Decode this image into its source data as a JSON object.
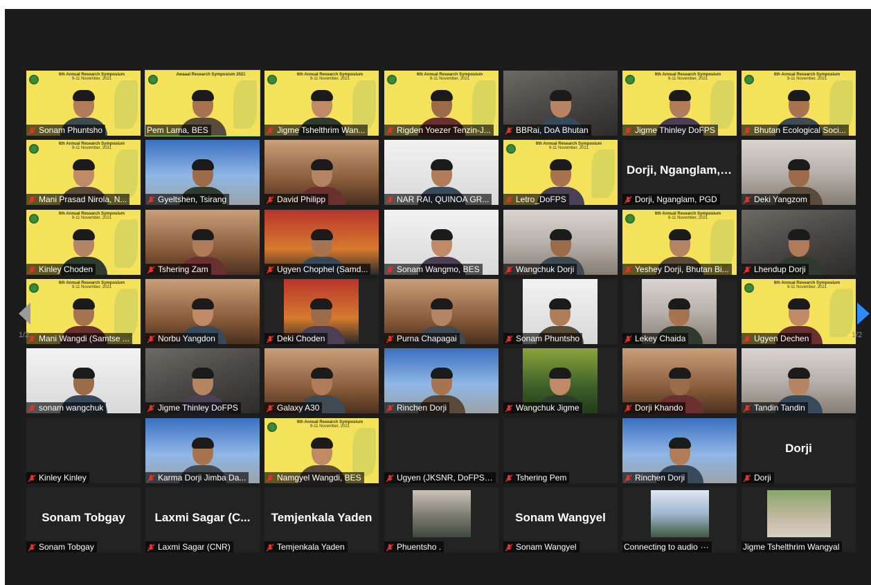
{
  "colors": {
    "stage_bg": "#1c1c1c",
    "tile_bg": "#232323",
    "active_border": "#9fe06a",
    "mic_muted": "#e0352b",
    "nav_right": "#2d8cff",
    "nav_left": "#9a9a9a"
  },
  "banner": {
    "symposium": "6th Annual Research Symposium",
    "dates": "9-11 November, 2021",
    "awaaal": "Awaaal Research Symposium 2021"
  },
  "pagination": {
    "left": "1/2",
    "right": "1/2"
  },
  "participants": [
    {
      "name": "Sonam Phuntsho",
      "muted": true,
      "bg": "yellow",
      "video": true
    },
    {
      "name": "Pem Lama, BES",
      "muted": false,
      "bg": "yellow",
      "video": true,
      "active": true
    },
    {
      "name": "Jigme Tshelthrim Wan...",
      "muted": true,
      "bg": "yellow",
      "video": true
    },
    {
      "name": "Rigden Yoezer Tenzin-J...",
      "muted": true,
      "bg": "yellow",
      "video": true
    },
    {
      "name": "BBRai, DoA Bhutan",
      "muted": true,
      "bg": "room",
      "video": true
    },
    {
      "name": "Jigme Thinley DoFPS",
      "muted": true,
      "bg": "yellow",
      "video": true
    },
    {
      "name": "Bhutan Ecological Soci...",
      "muted": true,
      "bg": "yellow",
      "video": true
    },
    {
      "name": "Mani Prasad Nirola, N...",
      "muted": true,
      "bg": "yellow",
      "video": true
    },
    {
      "name": "Gyeltshen, Tsirang",
      "muted": true,
      "bg": "sky",
      "video": true
    },
    {
      "name": "David Philipp",
      "muted": true,
      "bg": "warm",
      "video": true
    },
    {
      "name": "NAR RAI, QUINOA GR...",
      "muted": true,
      "bg": "white",
      "video": true
    },
    {
      "name": "Letro_DoFPS",
      "muted": true,
      "bg": "yellow",
      "video": true
    },
    {
      "name": "Dorji, Nganglam, PGD",
      "muted": true,
      "bg": "none",
      "video": false,
      "big": "Dorji, Nganglam, PGD"
    },
    {
      "name": "Deki Yangzom",
      "muted": true,
      "bg": "office",
      "video": true
    },
    {
      "name": "Kinley Choden",
      "muted": true,
      "bg": "yellow",
      "video": true
    },
    {
      "name": "Tshering Zam",
      "muted": true,
      "bg": "warm",
      "video": true
    },
    {
      "name": "Ugyen Chophel (Samd...",
      "muted": true,
      "bg": "red",
      "video": true
    },
    {
      "name": "Sonam Wangmo, BES",
      "muted": true,
      "bg": "white",
      "video": true
    },
    {
      "name": "Wangchuk Dorji",
      "muted": true,
      "bg": "office",
      "video": true
    },
    {
      "name": "Yeshey Dorji, Bhutan Bi...",
      "muted": true,
      "bg": "yellow",
      "video": true
    },
    {
      "name": "Lhendup Dorji",
      "muted": true,
      "bg": "room",
      "video": true
    },
    {
      "name": "Mani Wangdi (Samtse ...",
      "muted": true,
      "bg": "yellow",
      "video": true
    },
    {
      "name": "Norbu Yangdon",
      "muted": true,
      "bg": "warm",
      "video": true
    },
    {
      "name": "Deki Choden",
      "muted": true,
      "bg": "red",
      "video": true,
      "narrow": true
    },
    {
      "name": "Purna Chapagai",
      "muted": true,
      "bg": "warm",
      "video": true
    },
    {
      "name": "Sonam Phuntsho",
      "muted": true,
      "bg": "white",
      "video": true,
      "narrow": true
    },
    {
      "name": "Lekey Chaida",
      "muted": true,
      "bg": "office",
      "video": true,
      "narrow": true
    },
    {
      "name": "Ugyen Dechen",
      "muted": true,
      "bg": "yellow",
      "video": true
    },
    {
      "name": "sonam wangchuk",
      "muted": true,
      "bg": "white",
      "video": true
    },
    {
      "name": "Jigme Thinley DoFPS",
      "muted": true,
      "bg": "room",
      "video": true
    },
    {
      "name": "Galaxy A30",
      "muted": true,
      "bg": "warm",
      "video": true
    },
    {
      "name": "Rinchen Dorji",
      "muted": true,
      "bg": "sky",
      "video": true
    },
    {
      "name": "Wangchuk Jigme",
      "muted": true,
      "bg": "green",
      "video": true,
      "narrow": true
    },
    {
      "name": "Dorji Khando",
      "muted": true,
      "bg": "warm",
      "video": true
    },
    {
      "name": "Tandin Tandin",
      "muted": true,
      "bg": "office",
      "video": true
    },
    {
      "name": "Kinley Kinley",
      "muted": true,
      "bg": "none",
      "video": false
    },
    {
      "name": "Karma Dorji Jimba Da...",
      "muted": true,
      "bg": "sky",
      "video": true
    },
    {
      "name": "Namgyel Wangdi, BES",
      "muted": true,
      "bg": "yellow",
      "video": true
    },
    {
      "name": "Ugyen (JKSNR, DoFPS,...",
      "muted": true,
      "bg": "none",
      "video": false
    },
    {
      "name": "Tshering Pem",
      "muted": true,
      "bg": "none",
      "video": false
    },
    {
      "name": "Rinchen Dorji",
      "muted": true,
      "bg": "sky",
      "video": true
    },
    {
      "name": "Dorji",
      "muted": true,
      "bg": "none",
      "video": false,
      "big": "Dorji"
    },
    {
      "name": "Sonam Tobgay",
      "muted": true,
      "bg": "none",
      "video": false,
      "big": "Sonam Tobgay"
    },
    {
      "name": "Laxmi Sagar (CNR)",
      "muted": true,
      "bg": "none",
      "video": false,
      "big": "Laxmi Sagar (C..."
    },
    {
      "name": "Temjenkala Yaden",
      "muted": true,
      "bg": "none",
      "video": false,
      "big": "Temjenkala Yaden"
    },
    {
      "name": "Phuentsho .",
      "muted": true,
      "bg": "none",
      "video": false,
      "thumb": "photo"
    },
    {
      "name": "Sonam Wangyel",
      "muted": true,
      "bg": "none",
      "video": false,
      "big": "Sonam Wangyel"
    },
    {
      "name": "Connecting to audio",
      "muted": false,
      "bg": "none",
      "video": false,
      "thumb": "landscape",
      "connecting": true
    },
    {
      "name": "Jigme Tshelthrim Wangyal",
      "muted": false,
      "bg": "none",
      "video": false,
      "thumb": "portrait"
    }
  ]
}
